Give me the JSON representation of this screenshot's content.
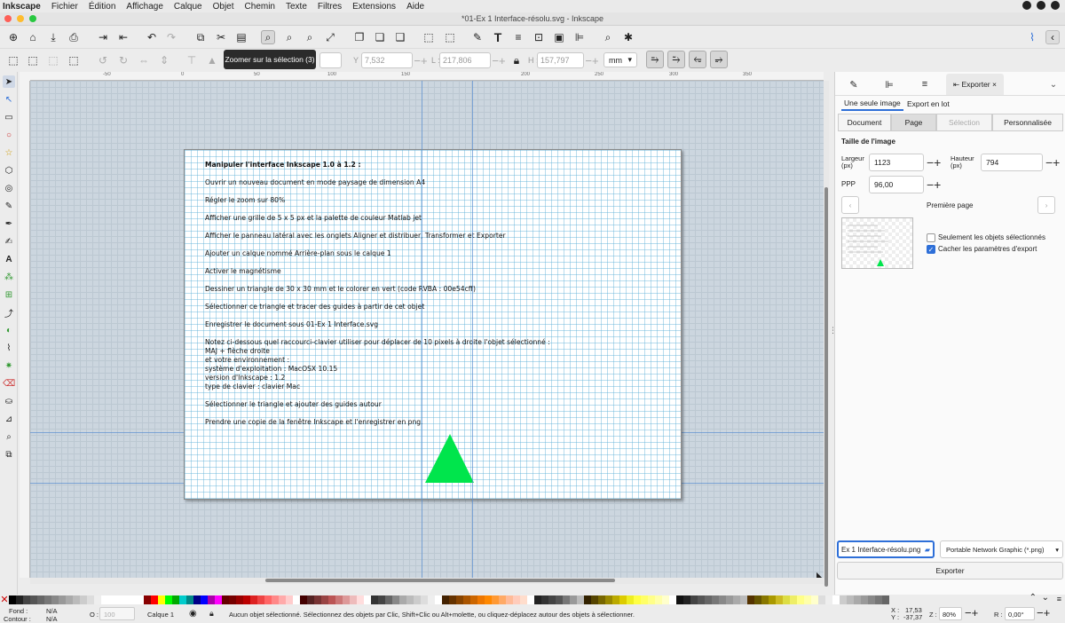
{
  "menubar": {
    "app": "Inkscape",
    "items": [
      "Fichier",
      "Édition",
      "Affichage",
      "Calque",
      "Objet",
      "Chemin",
      "Texte",
      "Filtres",
      "Extensions",
      "Aide"
    ]
  },
  "window": {
    "title": "*01-Ex 1 Interface-résolu.svg - Inkscape"
  },
  "tooltip": "Zoomer sur la sélection (3)",
  "selbar": {
    "x_label": "X :",
    "x_value": "",
    "y_label": "Y :",
    "y_value": "7,532",
    "w_label": "L :",
    "w_value": "217,806",
    "h_label": "H :",
    "h_value": "157,797",
    "unit": "mm"
  },
  "ruler_marks": [
    "-50",
    "0",
    "50",
    "100",
    "150",
    "200",
    "250",
    "300",
    "350"
  ],
  "document": {
    "heading": "Manipuler l'interface Inkscape 1.0 à 1.2 :",
    "lines": [
      "Ouvrir un nouveau document en mode paysage de dimension A4",
      "Régler le zoom sur 80%",
      "Afficher une grille de 5 x 5 px et la palette de couleur Matlab jet",
      "Afficher le panneau latéral avec les onglets Aligner et distribuer, Transformer et Exporter",
      "Ajouter un calque nommé Arrière-plan sous le calque 1",
      "Activer le magnétisme",
      "Dessiner un triangle de 30 x 30 mm et le colorer en vert (code RVBA : 00e54cff)",
      "Sélectionner ce triangle et tracer des guides à partir de cet objet",
      "Enregistrer le document sous 01-Ex 1 Interface.svg",
      "Notez ci-dessous quel raccourci-clavier utiliser pour déplacer de 10 pixels à droite l'objet sélectionné :\nMAJ + flèche droite\net votre environnement :\nsystème d'exploitation : MacOSX 10.15\nversion d'Inkscape : 1.2\ntype de clavier : clavier Mac",
      "Sélectionner le triangle et ajouter des guides autour",
      "Prendre une copie de la fenêtre Inkscape et l'enregistrer en png."
    ],
    "triangle_color": "#00e54c"
  },
  "panel": {
    "tab_label": "Exporter",
    "subtabs": [
      "Une seule image",
      "Export en lot"
    ],
    "segments": [
      "Document",
      "Page",
      "Sélection",
      "Personnalisée"
    ],
    "section_title": "Taille de l'image",
    "width_label": "Largeur\n(px)",
    "width_value": "1123",
    "height_label": "Hauteur\n(px)",
    "height_value": "794",
    "dpi_label": "PPP",
    "dpi_value": "96,00",
    "page_nav": "Première page",
    "only_selected": "Seulement les objets sélectionnés",
    "hide_export": "Cacher les paramètres d'export",
    "filename": "Ex 1 Interface-résolu.png",
    "format": "Portable Network Graphic (*.png)",
    "export_button": "Exporter"
  },
  "status": {
    "fill_label": "Fond :",
    "fill_value": "N/A",
    "stroke_label": "Contour :",
    "stroke_value": "N/A",
    "opacity_label": "O :",
    "opacity_value": "100",
    "layer": "Calque 1",
    "message": "Aucun objet sélectionné. Sélectionnez des objets par Clic, Shift+Clic ou Alt+molette, ou cliquez-déplacez autour des objets à sélectionner.",
    "x_label": "X :",
    "x_value": "17,53",
    "y_label": "Y :",
    "y_value": "-37,37",
    "zoom_label": "Z :",
    "zoom_value": "80%",
    "rot_label": "R :",
    "rot_value": "0,00°"
  },
  "colors": {
    "accent": "#2e6fd8",
    "canvas": "#ccd6df",
    "guide": "#5a8fd0"
  }
}
